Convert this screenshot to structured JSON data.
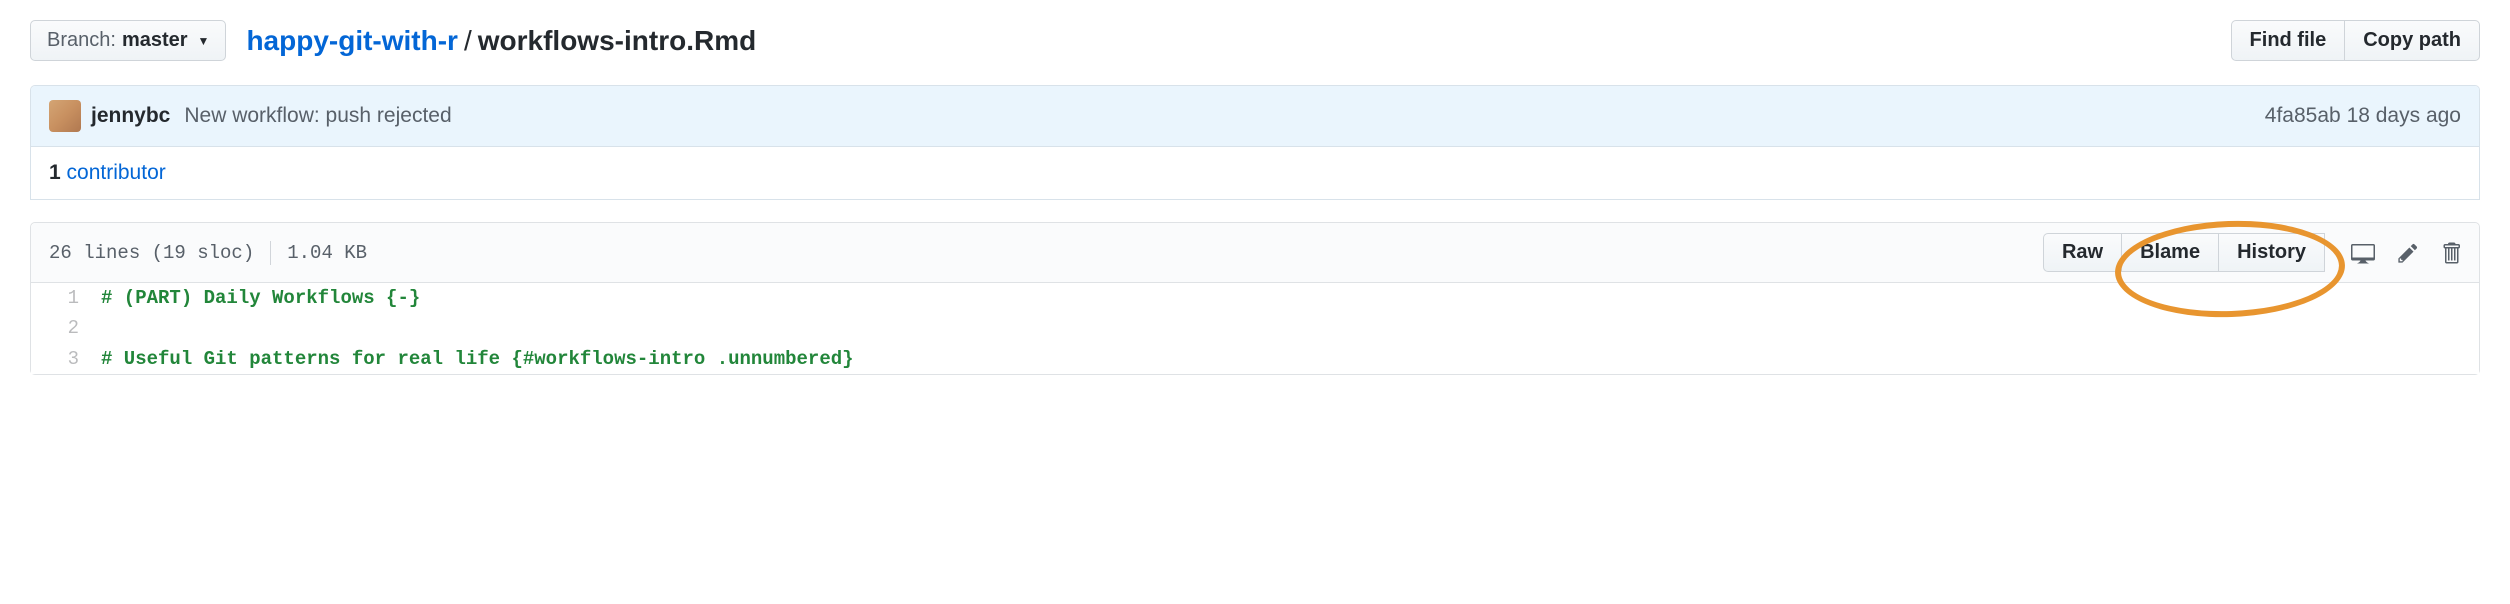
{
  "branch": {
    "label": "Branch:",
    "name": "master"
  },
  "breadcrumb": {
    "repo": "happy-git-with-r",
    "separator": "/",
    "file": "workflows-intro.Rmd"
  },
  "actions": {
    "find_file": "Find file",
    "copy_path": "Copy path"
  },
  "commit": {
    "author": "jennybc",
    "message": "New workflow: push rejected",
    "sha": "4fa85ab",
    "time": "18 days ago"
  },
  "contributors": {
    "count": "1",
    "label": "contributor"
  },
  "file_meta": {
    "lines": "26 lines (19 sloc)",
    "size": "1.04 KB"
  },
  "file_actions": {
    "raw": "Raw",
    "blame": "Blame",
    "history": "History"
  },
  "code": {
    "line1_num": "1",
    "line1": "# (PART) Daily Workflows {-}",
    "line2_num": "2",
    "line2": "",
    "line3_num": "3",
    "line3": "# Useful Git patterns for real life {#workflows-intro .unnumbered}"
  }
}
